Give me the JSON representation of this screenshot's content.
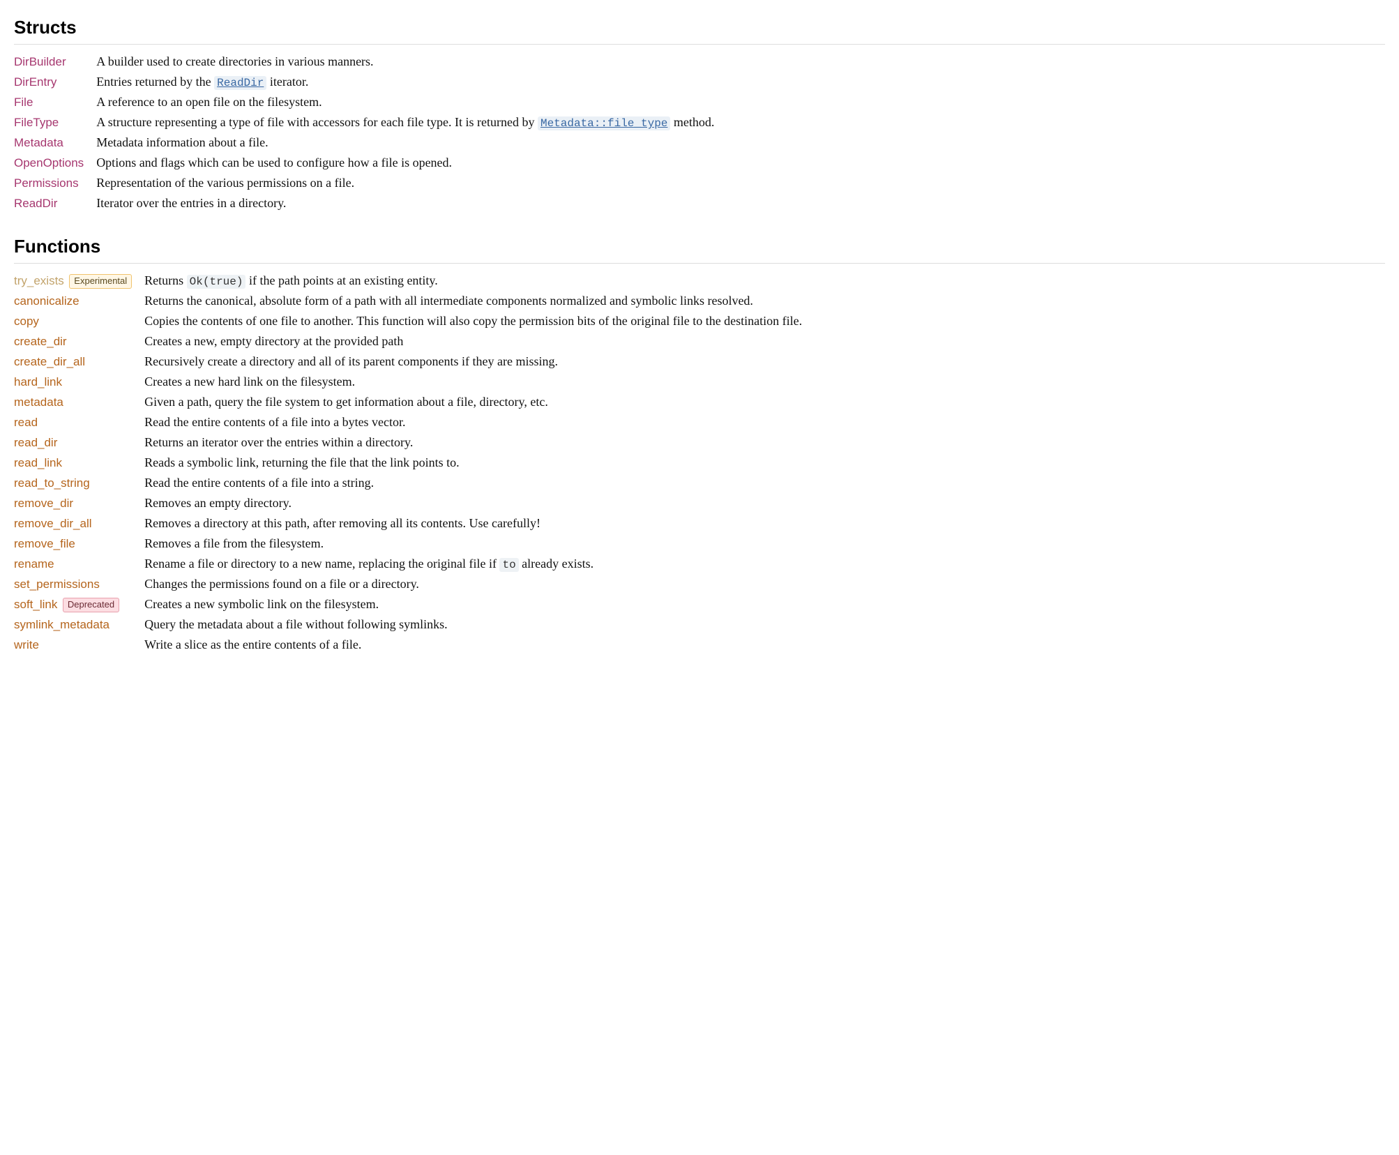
{
  "sections": {
    "structs": {
      "heading": "Structs",
      "items": [
        {
          "name": "DirBuilder",
          "desc": "A builder used to create directories in various manners."
        },
        {
          "name": "DirEntry",
          "desc_pre": "Entries returned by the ",
          "code_ref": "ReadDir",
          "desc_post": " iterator."
        },
        {
          "name": "File",
          "desc": "A reference to an open file on the filesystem."
        },
        {
          "name": "FileType",
          "desc_pre": "A structure representing a type of file with accessors for each file type. It is returned by ",
          "code_ref": "Metadata::file_type",
          "desc_post": " method."
        },
        {
          "name": "Metadata",
          "desc": "Metadata information about a file."
        },
        {
          "name": "OpenOptions",
          "desc": "Options and flags which can be used to configure how a file is opened."
        },
        {
          "name": "Permissions",
          "desc": "Representation of the various permissions on a file."
        },
        {
          "name": "ReadDir",
          "desc": "Iterator over the entries in a directory."
        }
      ]
    },
    "functions": {
      "heading": "Functions",
      "items": [
        {
          "name": "try_exists",
          "badge": "Experimental",
          "unstable": true,
          "desc_pre": "Returns ",
          "code_inline": "Ok(true)",
          "desc_post": " if the path points at an existing entity."
        },
        {
          "name": "canonicalize",
          "desc": "Returns the canonical, absolute form of a path with all intermediate components normalized and symbolic links resolved."
        },
        {
          "name": "copy",
          "desc": "Copies the contents of one file to another. This function will also copy the permission bits of the original file to the destination file."
        },
        {
          "name": "create_dir",
          "desc": "Creates a new, empty directory at the provided path"
        },
        {
          "name": "create_dir_all",
          "desc": "Recursively create a directory and all of its parent components if they are missing."
        },
        {
          "name": "hard_link",
          "desc": "Creates a new hard link on the filesystem."
        },
        {
          "name": "metadata",
          "desc": "Given a path, query the file system to get information about a file, directory, etc."
        },
        {
          "name": "read",
          "desc": "Read the entire contents of a file into a bytes vector."
        },
        {
          "name": "read_dir",
          "desc": "Returns an iterator over the entries within a directory."
        },
        {
          "name": "read_link",
          "desc": "Reads a symbolic link, returning the file that the link points to."
        },
        {
          "name": "read_to_string",
          "desc": "Read the entire contents of a file into a string."
        },
        {
          "name": "remove_dir",
          "desc": "Removes an empty directory."
        },
        {
          "name": "remove_dir_all",
          "desc": "Removes a directory at this path, after removing all its contents. Use carefully!"
        },
        {
          "name": "remove_file",
          "desc": "Removes a file from the filesystem."
        },
        {
          "name": "rename",
          "desc_pre": "Rename a file or directory to a new name, replacing the original file if ",
          "code_inline": "to",
          "desc_post": " already exists."
        },
        {
          "name": "set_permissions",
          "desc": "Changes the permissions found on a file or a directory."
        },
        {
          "name": "soft_link",
          "badge": "Deprecated",
          "desc": "Creates a new symbolic link on the filesystem."
        },
        {
          "name": "symlink_metadata",
          "desc": "Query the metadata about a file without following symlinks."
        },
        {
          "name": "write",
          "desc": "Write a slice as the entire contents of a file."
        }
      ]
    }
  }
}
